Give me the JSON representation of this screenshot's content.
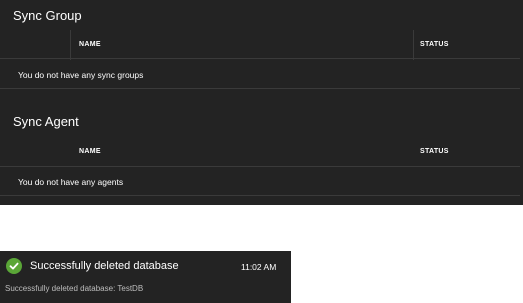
{
  "sync_group": {
    "title": "Sync Group",
    "columns": [
      "NAME",
      "STATUS"
    ],
    "empty_message": "You do not have any sync groups"
  },
  "sync_agent": {
    "title": "Sync Agent",
    "columns": [
      "NAME",
      "STATUS"
    ],
    "empty_message": "You do not have any agents"
  },
  "toast": {
    "icon": "checkmark-circle-icon",
    "title": "Successfully deleted database",
    "time": "11:02 AM",
    "body": "Successfully deleted database: TestDB",
    "accent_color": "#5aa637"
  }
}
